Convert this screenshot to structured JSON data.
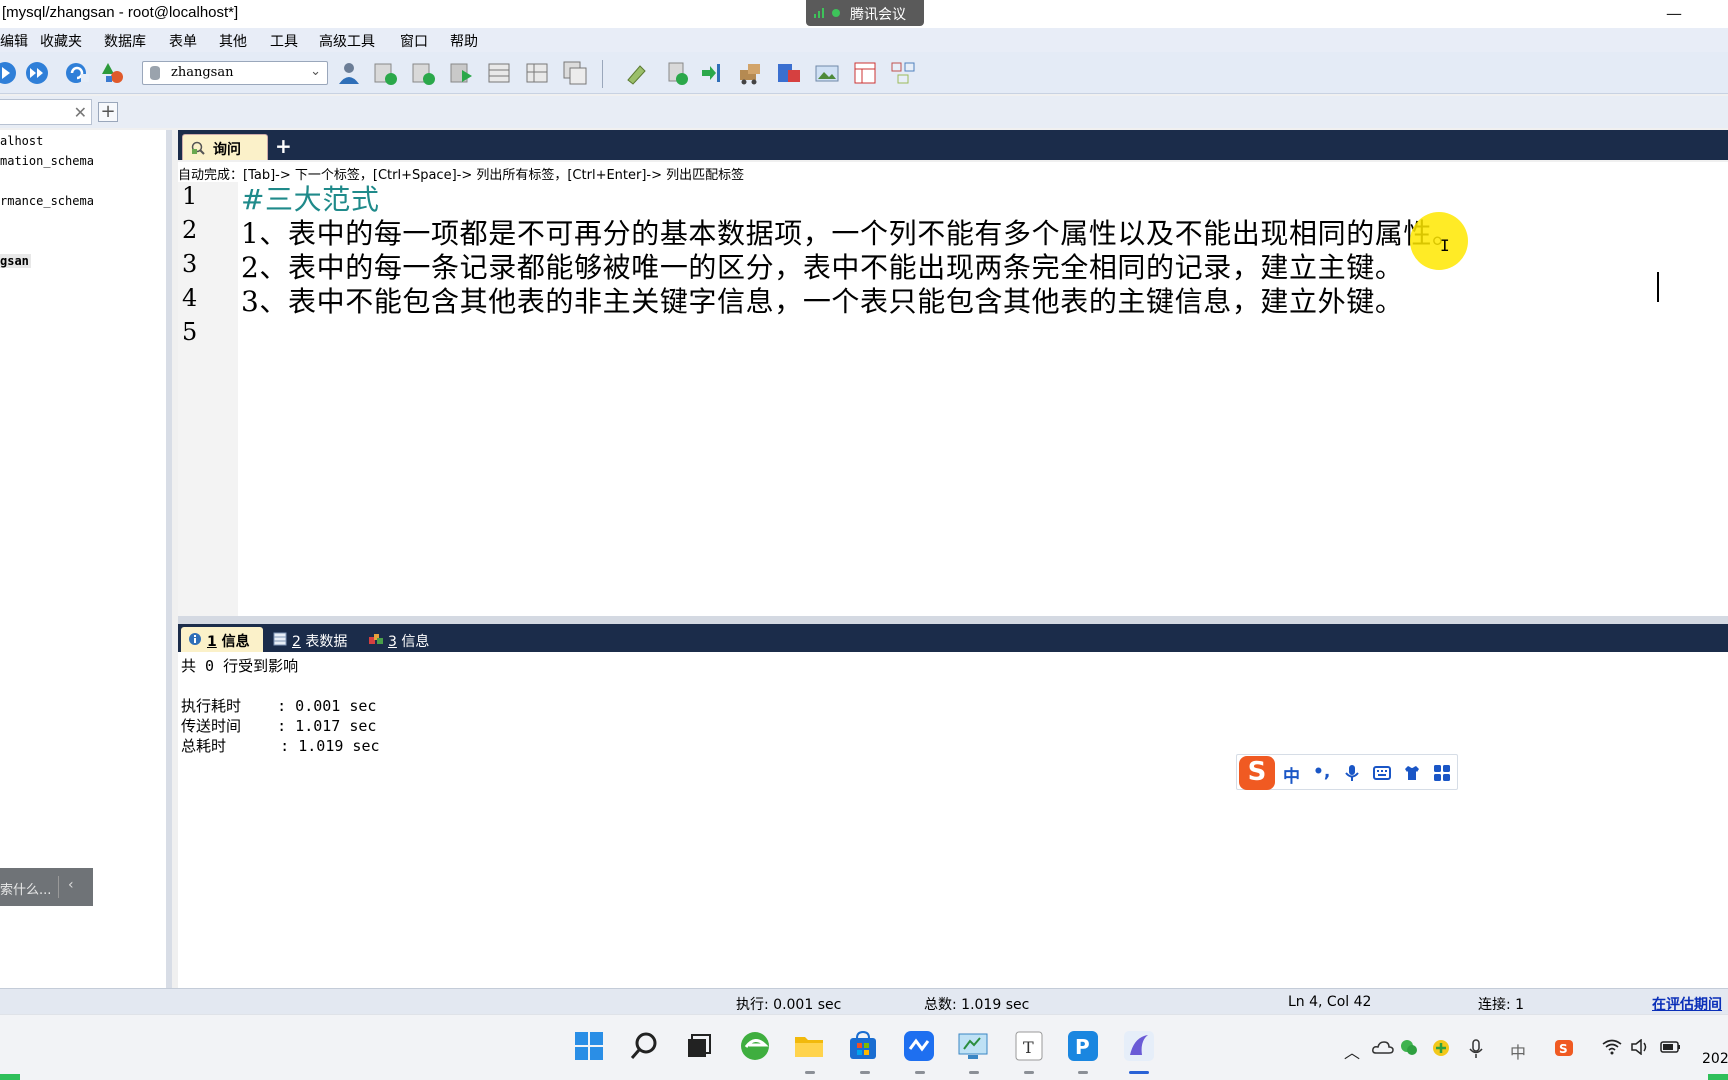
{
  "window": {
    "title": "[mysql/zhangsan - root@localhost*]",
    "meeting_badge": "腾讯会议",
    "minimize_glyph": "—"
  },
  "menu": [
    "编辑",
    "收藏夹",
    "数据库",
    "表单",
    "其他",
    "工具",
    "高级工具",
    "窗口",
    "帮助"
  ],
  "toolbar": {
    "database_selected": "zhangsan"
  },
  "connection_tab": {
    "close_glyph": "✕",
    "add_glyph": "+"
  },
  "object_tree": {
    "items": [
      "alhost",
      "mation_schema",
      "rmance_schema",
      "gsan"
    ],
    "search_hint": "索什么..."
  },
  "query": {
    "tab_label": "询问",
    "add_glyph": "+",
    "autocomplete_hint": "自动完成：[Tab]-> 下一个标签，[Ctrl+Space]-> 列出所有标签，[Ctrl+Enter]-> 列出匹配标签",
    "line_numbers": [
      "1",
      "2",
      "3",
      "4",
      "5"
    ],
    "lines": [
      "#三大范式",
      "1、表中的每一项都是不可再分的基本数据项，一个列不能有多个属性以及不能出现相同的属性。",
      "2、表中的每一条记录都能够被唯一的区分，表中不能出现两条完全相同的记录，建立主键。",
      "3、表中不能包含其他表的非主关键字信息，一个表只能包含其他表的主键信息，建立外键。",
      ""
    ]
  },
  "results": {
    "tabs": [
      {
        "num": "1",
        "label": " 信息"
      },
      {
        "num": "2",
        "label": " 表数据"
      },
      {
        "num": "3",
        "label": " 信息"
      }
    ],
    "lines": [
      "共 0 行受到影响",
      "",
      "执行耗时    : 0.001 sec",
      "传送时间    : 1.017 sec",
      "总耗时      : 1.019 sec"
    ]
  },
  "ime": {
    "logo": "S",
    "mode": "中",
    "punct": "•,"
  },
  "status": {
    "exec": "执行: 0.001 sec",
    "total": "总数: 1.019 sec",
    "position": "Ln 4, Col 42",
    "connections": "连接: 1",
    "eval": "在评估期间"
  },
  "taskbar": {
    "clock_partial": "202",
    "tray_ime": "中"
  },
  "colors": {
    "tab_header_bg": "#1b2c4a",
    "active_tab_bg": "#fbf1c9",
    "comment_color": "#1f8a8a",
    "cursor_highlight": "#ffe800"
  }
}
